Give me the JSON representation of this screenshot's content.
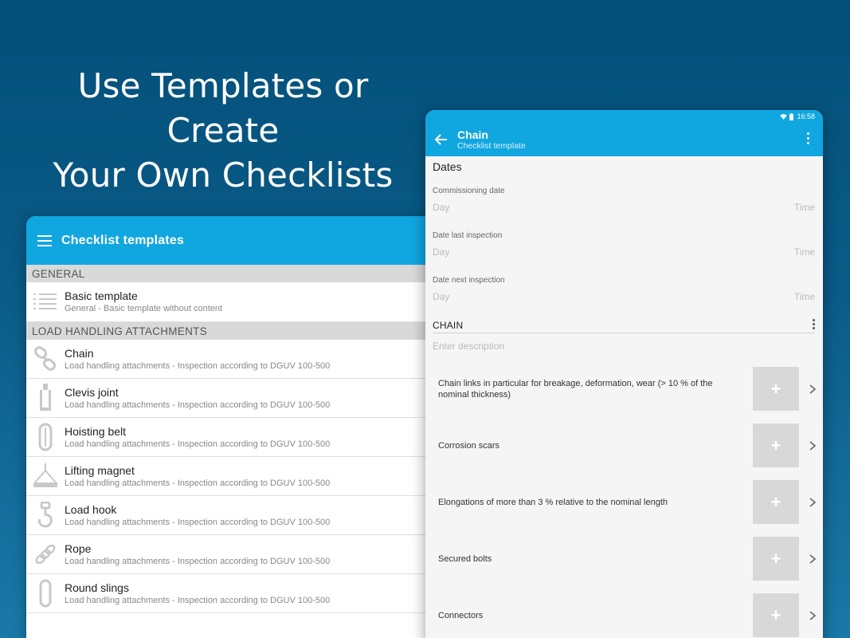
{
  "headline": {
    "line1": "Use Templates or Create",
    "line2": "Your Own Checklists"
  },
  "left_panel": {
    "title": "Checklist templates",
    "sections": [
      {
        "header": "GENERAL",
        "items": [
          {
            "title": "Basic template",
            "subtitle": "General - Basic template without content",
            "icon": "list-icon"
          }
        ]
      },
      {
        "header": "LOAD HANDLING ATTACHMENTS",
        "items": [
          {
            "title": "Chain",
            "subtitle": "Load handling attachments - Inspection according to DGUV 100-500",
            "icon": "chain-icon"
          },
          {
            "title": "Clevis joint",
            "subtitle": "Load handling attachments - Inspection according to DGUV 100-500",
            "icon": "clevis-icon"
          },
          {
            "title": "Hoisting belt",
            "subtitle": "Load handling attachments - Inspection according to DGUV 100-500",
            "icon": "belt-icon"
          },
          {
            "title": "Lifting magnet",
            "subtitle": "Load handling attachments - Inspection according to DGUV 100-500",
            "icon": "magnet-icon"
          },
          {
            "title": "Load hook",
            "subtitle": "Load handling attachments - Inspection according to DGUV 100-500",
            "icon": "hook-icon"
          },
          {
            "title": "Rope",
            "subtitle": "Load handling attachments - Inspection according to DGUV 100-500",
            "icon": "rope-icon"
          },
          {
            "title": "Round slings",
            "subtitle": "Load handling attachments - Inspection according to DGUV 100-500",
            "icon": "sling-icon"
          }
        ]
      }
    ]
  },
  "right_panel": {
    "status_time": "16:58",
    "title": "Chain",
    "subtitle": "Checklist template",
    "dates_header": "Dates",
    "dates": [
      {
        "label": "Commissioning date",
        "day": "Day",
        "time": "Time"
      },
      {
        "label": "Date last inspection",
        "day": "Day",
        "time": "Time"
      },
      {
        "label": "Date next inspection",
        "day": "Day",
        "time": "Time"
      }
    ],
    "section_header": "CHAIN",
    "description_placeholder": "Enter description",
    "checks": [
      {
        "text": "Chain links in particular for breakage, deformation, wear (> 10 % of the nominal thickness)",
        "add": "+"
      },
      {
        "text": "Corrosion scars",
        "add": "+"
      },
      {
        "text": "Elongations of more than 3 % relative to the nominal length",
        "add": "+"
      },
      {
        "text": "Secured bolts",
        "add": "+"
      },
      {
        "text": "Connectors",
        "add": "+"
      }
    ]
  },
  "colors": {
    "accent": "#10a6e0",
    "background_top": "#03507a",
    "section_bg": "#d9d9d9",
    "icon_gray": "#c8c8c8"
  }
}
